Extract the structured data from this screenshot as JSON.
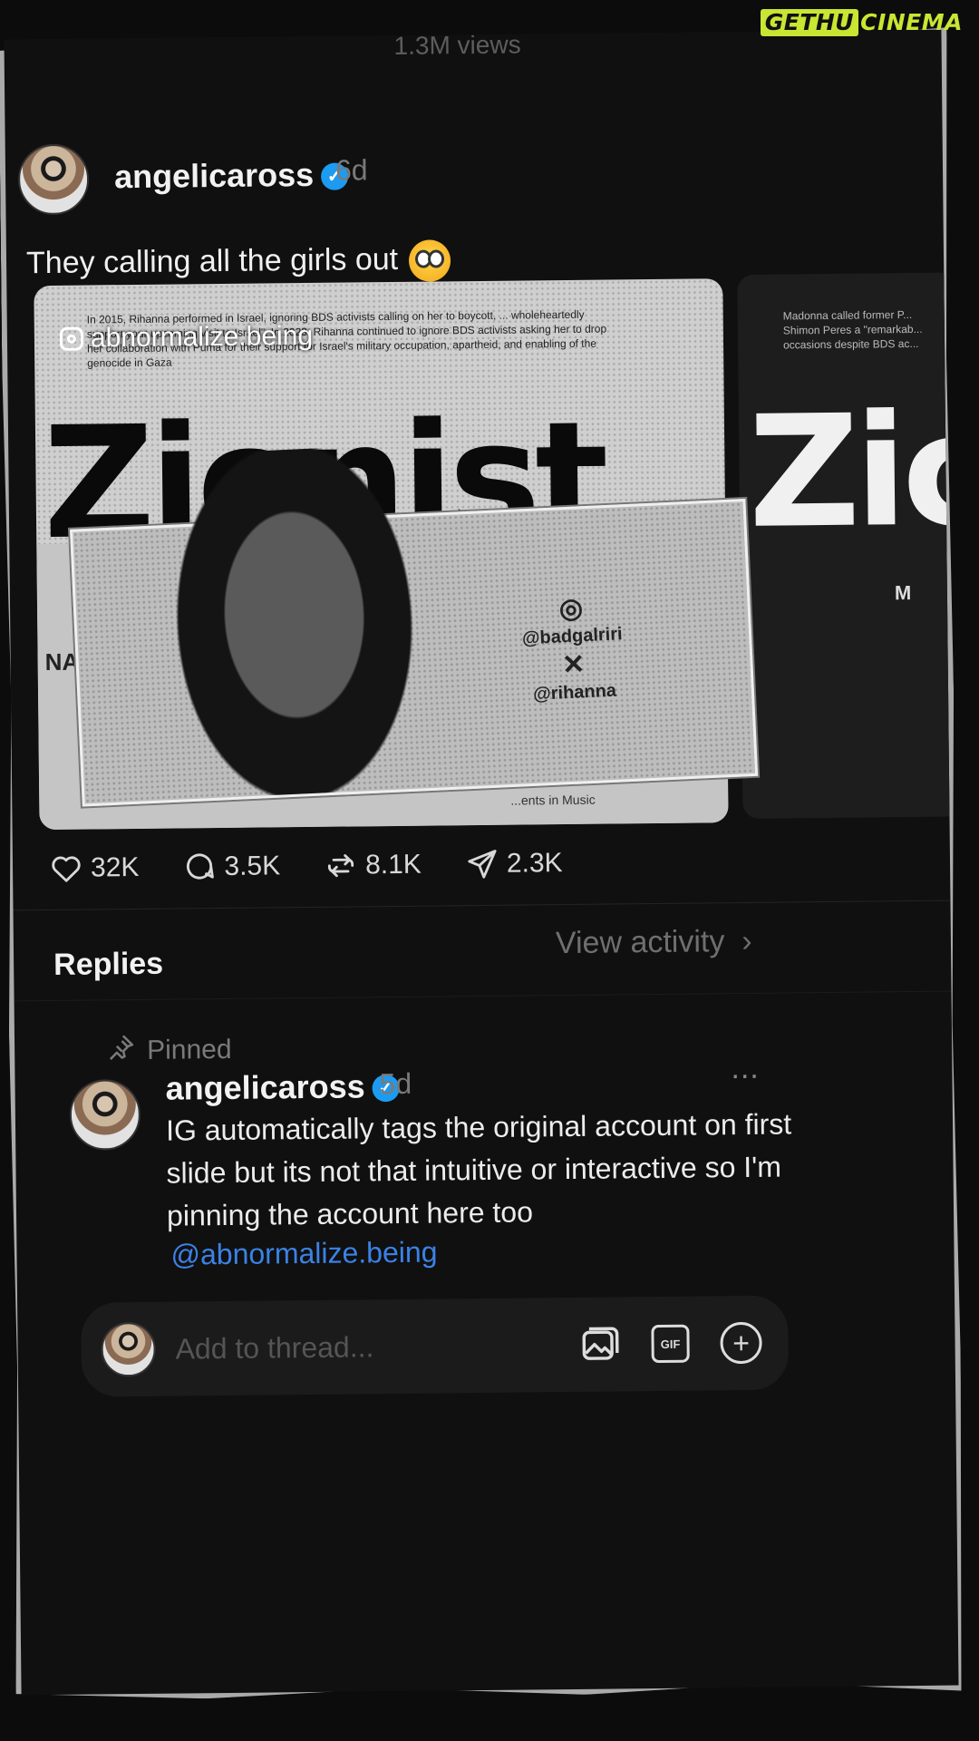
{
  "brand": {
    "part1": "GETHU",
    "part2": "CINEMA"
  },
  "post": {
    "views": "1.3M views",
    "username": "angelicaross",
    "time": "6d",
    "caption": "They calling all the girls out",
    "media": {
      "overlay_handle": "abnormalize.being",
      "body_text": "In 2015, Rihanna performed in Israel, ignoring BDS activists calling on her to boycott, ... wholeheartedly support your upcoming visit to Israel\". In 2023, Rihanna continued to ignore BDS activists asking her to drop her collaboration with Puma for their support for Israel's military occupation, apartheid, and enabling of the genocide in Gaza",
      "headline": "Zionist",
      "side_label": "NA",
      "instagram_handle": "@badgalriri",
      "x_handle": "@rihanna",
      "footer": "...ents in Music",
      "next_card_text": "Madonna called former P... Shimon Peres a \"remarkab... occasions despite BDS ac...",
      "next_card_headline": "Zic",
      "next_card_letter": "M"
    },
    "actions": {
      "likes": "32K",
      "comments": "3.5K",
      "reposts": "8.1K",
      "shares": "2.3K"
    }
  },
  "replies": {
    "title": "Replies",
    "view_activity": "View activity",
    "pinned_label": "Pinned",
    "reply": {
      "username": "angelicaross",
      "time": "5d",
      "text": "IG automatically tags the original account on first slide but its not that intuitive or interactive so I'm pinning the account here too",
      "mention": "@abnormalize.being",
      "more_label": "..."
    }
  },
  "composer": {
    "placeholder": "Add to thread..."
  }
}
